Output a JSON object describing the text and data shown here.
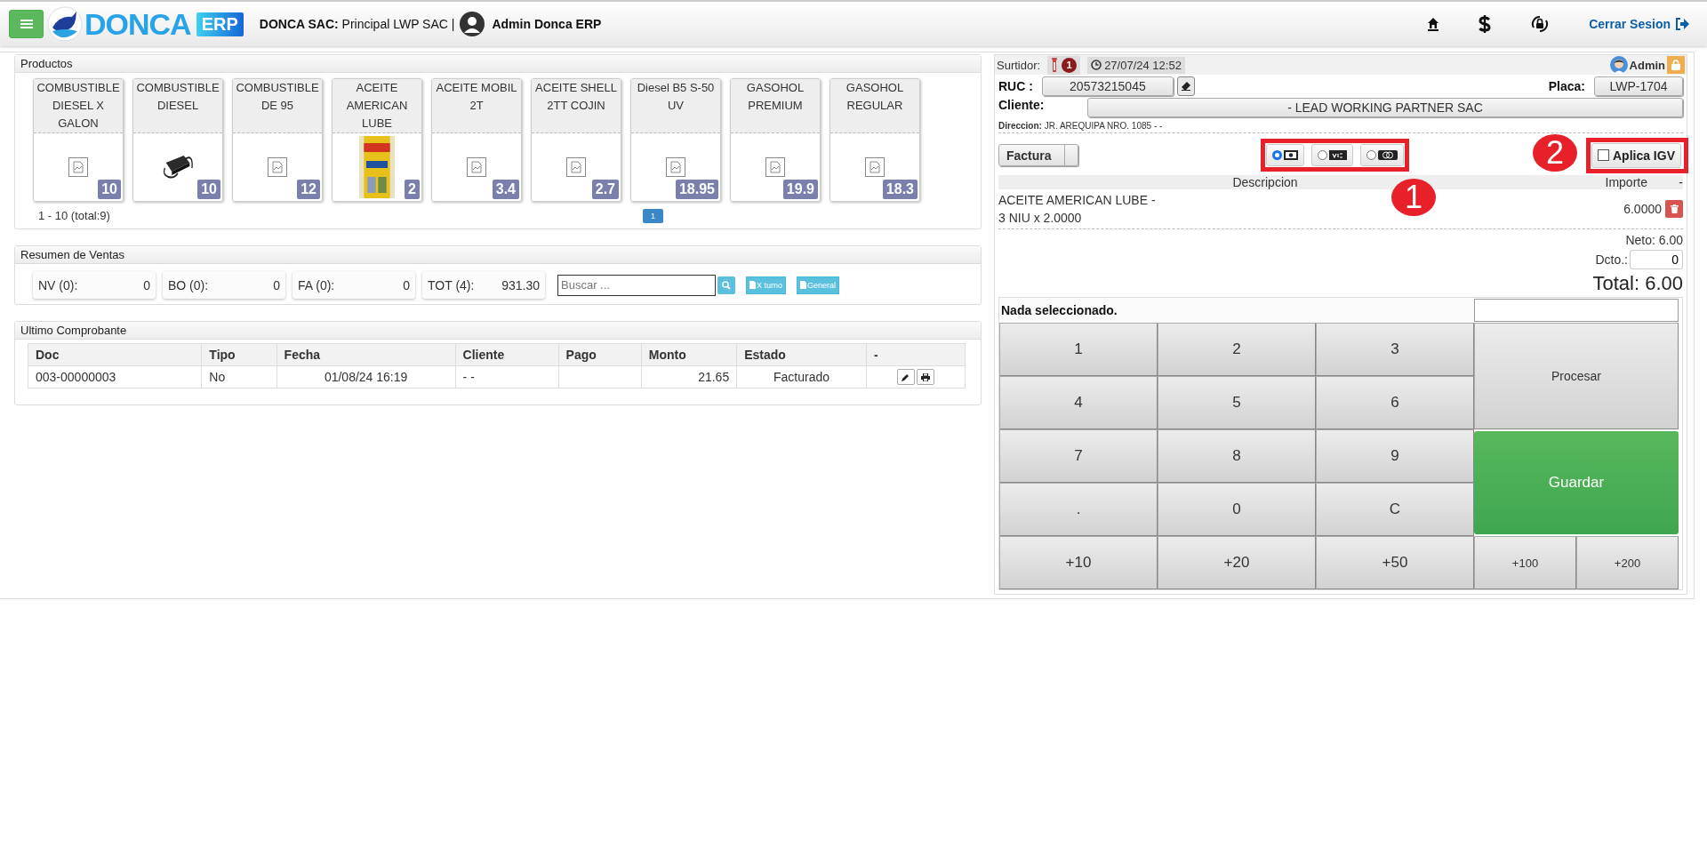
{
  "header": {
    "brand": "DONCA",
    "brand_tag": "ERP",
    "company_label": "DONCA SAC:",
    "company": "Principal LWP SAC |",
    "user": "Admin Donca ERP",
    "logout": "Cerrar Sesion"
  },
  "products": {
    "title": "Productos",
    "range": "1 - 10 (total:9)",
    "items": [
      {
        "name": "COMBUSTIBLE DIESEL X GALON",
        "price": "10",
        "kind": "no_image"
      },
      {
        "name": "COMBUSTIBLE DIESEL",
        "price": "10",
        "kind": "picture"
      },
      {
        "name": "COMBUSTIBLE DE 95",
        "price": "12",
        "kind": "no_image"
      },
      {
        "name": "ACEITE AMERICAN LUBE",
        "price": "2",
        "kind": "picture"
      },
      {
        "name": "ACEITE MOBIL 2T",
        "price": "3.4",
        "kind": "no_image"
      },
      {
        "name": "ACEITE SHELL 2TT COJIN",
        "price": "2.7",
        "kind": "no_image"
      },
      {
        "name": "Diesel B5 S-50 UV",
        "price": "18.95",
        "kind": "no_image"
      },
      {
        "name": "GASOHOL PREMIUM",
        "price": "19.9",
        "kind": "no_image"
      },
      {
        "name": "GASOHOL REGULAR",
        "price": "18.3",
        "kind": "no_image"
      }
    ],
    "pages": [
      {
        "label": "1",
        "selected": true
      }
    ]
  },
  "summary": {
    "title": "Resumen de Ventas",
    "search_placeholder": "Buscar ...",
    "stats": [
      {
        "label": "NV (0):",
        "value": "0"
      },
      {
        "label": "BO (0):",
        "value": "0"
      },
      {
        "label": "FA (0):",
        "value": "0"
      },
      {
        "label": "TOT (4):",
        "value": "931.30"
      }
    ],
    "buttons": [
      "X turno",
      "General"
    ]
  },
  "last_receipt": {
    "title": "Ultimo Comprobante",
    "columns": [
      "Doc",
      "Tipo",
      "Fecha",
      "Cliente",
      "Pago",
      "Monto",
      "Estado",
      "-"
    ],
    "rows": [
      {
        "doc": "003-00000003",
        "tipo": "No",
        "fecha": "01/08/24 16:19",
        "cliente": "- -",
        "monto": "21.65",
        "estado": "Facturado"
      }
    ]
  },
  "pos": {
    "surtidor_label": "Surtidor:",
    "surtidor_count": "1",
    "datetime": "27/07/24 12:52",
    "user": "Admin",
    "ruc_label": "RUC :",
    "ruc": "20573215045",
    "placa_label": "Placa:",
    "placa": "LWP-1704",
    "cliente_label": "Cliente:",
    "cliente": "- LEAD WORKING PARTNER SAC",
    "direccion_label": "Direccion:",
    "direccion": "JR. AREQUIPA NRO. 1085 - -",
    "doc_type": "Factura",
    "payments": [
      {
        "kind": "cash",
        "selected": true
      },
      {
        "kind": "visa",
        "selected": false
      },
      {
        "kind": "card",
        "selected": false
      }
    ],
    "igv": {
      "label": "Aplica IGV",
      "checked": false
    },
    "columns": [
      "Descripcion",
      "Importe",
      "-"
    ],
    "lines": [
      {
        "description": "ACEITE AMERICAN LUBE -",
        "detail": "3 NIU x 2.0000",
        "amount": "6.0000"
      }
    ],
    "neto": "Neto: 6.00",
    "dcto_label": "Dcto.:",
    "dcto": "0",
    "total": "Total: 6.00",
    "status": "Nada seleccionado.",
    "keys": [
      "1",
      "2",
      "3",
      "4",
      "5",
      "6",
      "7",
      "8",
      "9",
      ".",
      "0",
      "C",
      "+10",
      "+20",
      "+50"
    ],
    "procesar": "Procesar",
    "guardar": "Guardar",
    "extra_keys": [
      "+100",
      "+200"
    ]
  },
  "annotations": [
    {
      "label": "1"
    },
    {
      "label": "2"
    }
  ]
}
